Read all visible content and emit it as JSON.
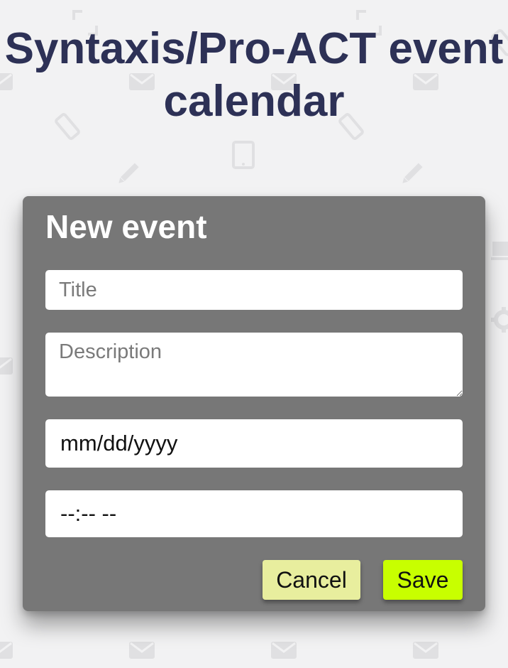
{
  "header": {
    "title": "Syntaxis/Pro-ACT event calendar"
  },
  "dialog": {
    "title": "New event",
    "title_field": {
      "value": "",
      "placeholder": "Title"
    },
    "description_field": {
      "value": "",
      "placeholder": "Description"
    },
    "date_field": {
      "value": "mm/dd/yyyy"
    },
    "time_field": {
      "value": "--:-- --"
    },
    "cancel_label": "Cancel",
    "save_label": "Save"
  },
  "colors": {
    "background": "#f2f2f3",
    "title_text": "#2d3156",
    "dialog_bg": "#777777",
    "cancel_button": "#e8ee9e",
    "save_button": "#c8ff00"
  },
  "background_icons": [
    "envelope-icon",
    "phone-icon",
    "tablet-icon",
    "pencil-icon",
    "coffee-cup-icon",
    "gear-icon",
    "paper-plane-icon",
    "expand-icon"
  ]
}
